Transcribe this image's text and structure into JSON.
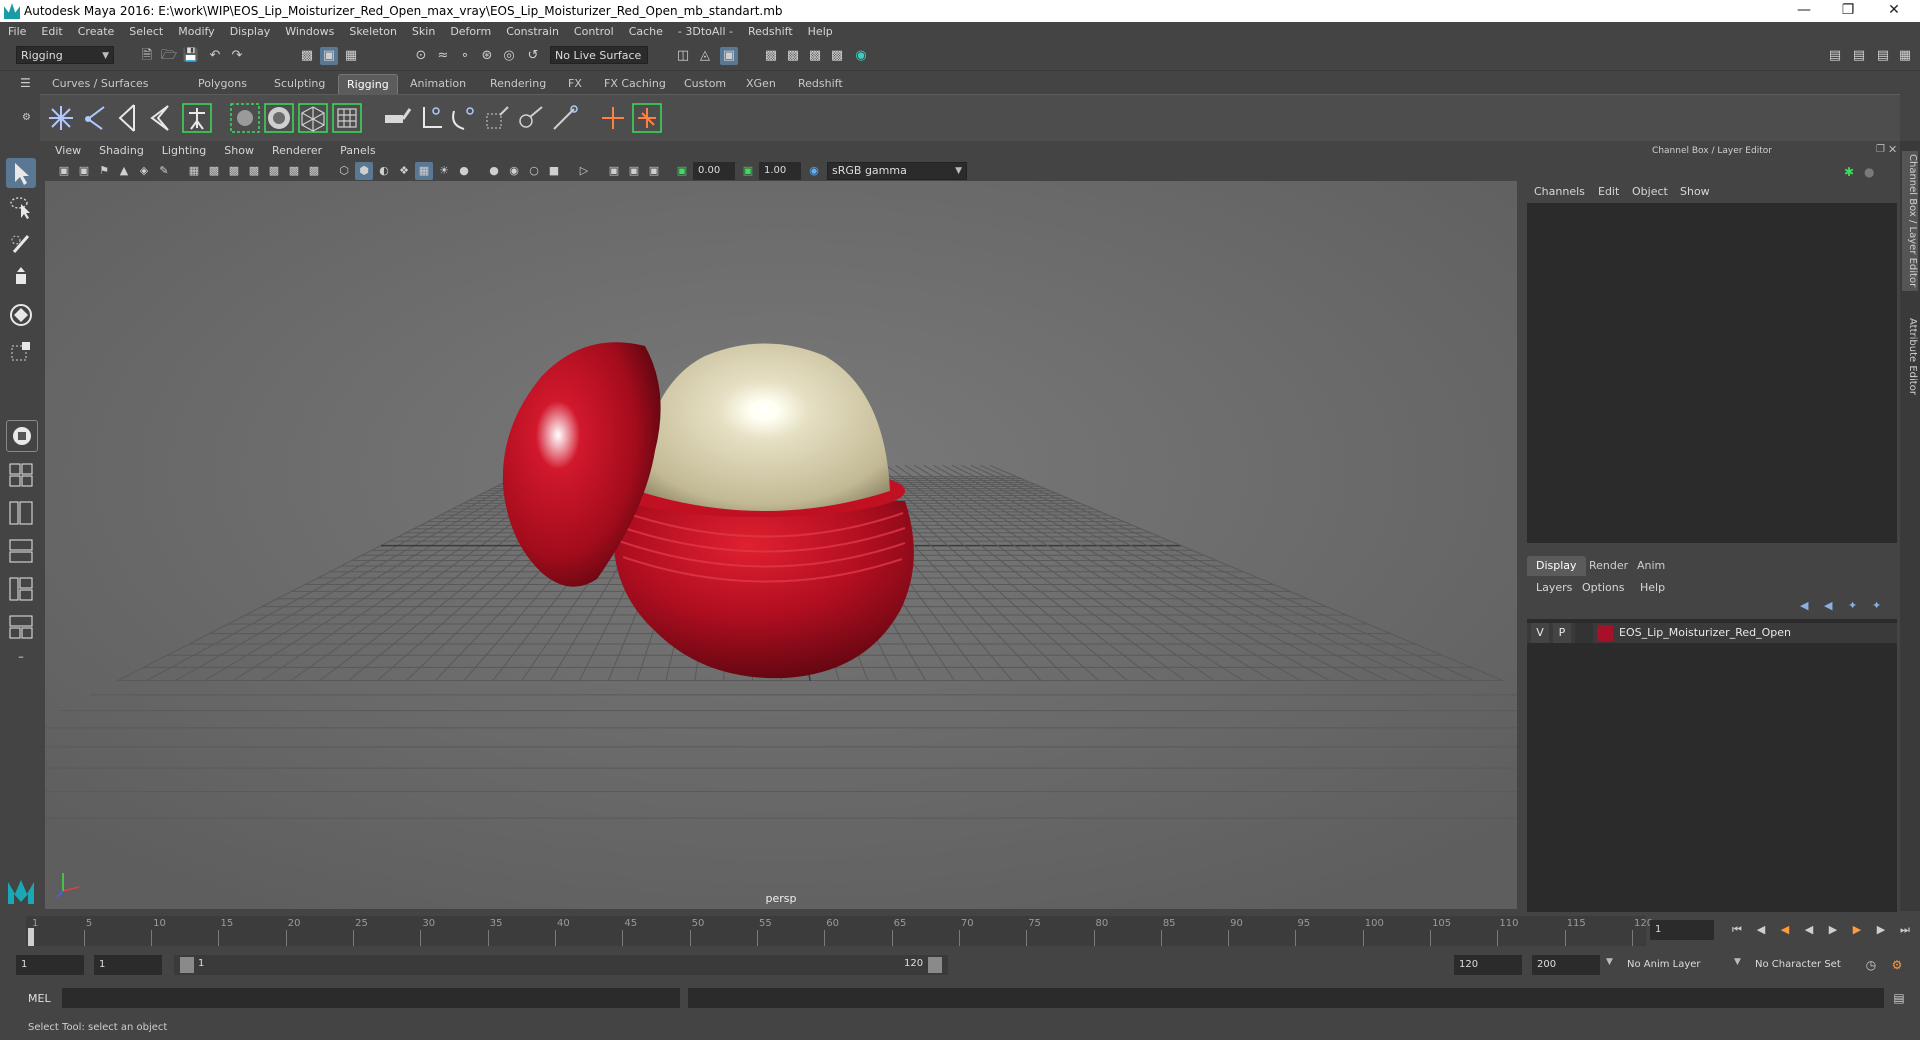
{
  "window": {
    "title": "Autodesk Maya 2016: E:\\work\\WIP\\EOS_Lip_Moisturizer_Red_Open_max_vray\\EOS_Lip_Moisturizer_Red_Open_mb_standart.mb"
  },
  "menubar": [
    "File",
    "Edit",
    "Create",
    "Select",
    "Modify",
    "Display",
    "Windows",
    "Skeleton",
    "Skin",
    "Deform",
    "Constrain",
    "Control",
    "Cache",
    "- 3DtoAll -",
    "Redshift",
    "Help"
  ],
  "statusline": {
    "menuset": "Rigging",
    "live_surface": "No Live Surface"
  },
  "shelf": {
    "tabs": [
      "Curves / Surfaces",
      "Polygons",
      "Sculpting",
      "Rigging",
      "Animation",
      "Rendering",
      "FX",
      "FX Caching",
      "Custom",
      "XGen",
      "Redshift"
    ],
    "active_tab": "Rigging"
  },
  "viewport": {
    "menu": [
      "View",
      "Shading",
      "Lighting",
      "Show",
      "Renderer",
      "Panels"
    ],
    "exposure": "0.00",
    "gamma": "1.00",
    "colorspace": "sRGB gamma",
    "camera_label": "persp"
  },
  "channel_box": {
    "title": "Channel Box / Layer Editor",
    "menu": [
      "Channels",
      "Edit",
      "Object",
      "Show"
    ],
    "layer_tabs": [
      "Display",
      "Render",
      "Anim"
    ],
    "active_layer_tab": "Display",
    "layer_menu": [
      "Layers",
      "Options",
      "Help"
    ],
    "layers": [
      {
        "visible": "V",
        "playback": "P",
        "name": "EOS_Lip_Moisturizer_Red_Open",
        "color": "#a8102a"
      }
    ]
  },
  "side_tabs": [
    "Channel Box / Layer Editor",
    "Attribute Editor"
  ],
  "time_slider": {
    "labels": [
      "1",
      "5",
      "10",
      "15",
      "20",
      "25",
      "30",
      "35",
      "40",
      "45",
      "50",
      "55",
      "60",
      "65",
      "70",
      "75",
      "80",
      "85",
      "90",
      "95",
      "100",
      "105",
      "110",
      "115",
      "120"
    ],
    "current_frame": "1"
  },
  "range_slider": {
    "start": "1",
    "playback_start": "1",
    "range_handle_start": "1",
    "range_handle_end": "120",
    "playback_end": "120",
    "end": "200",
    "anim_layer": "No Anim Layer",
    "character_set": "No Character Set"
  },
  "command_line": {
    "label": "MEL"
  },
  "help_line": {
    "text": "Select Tool: select an object"
  }
}
